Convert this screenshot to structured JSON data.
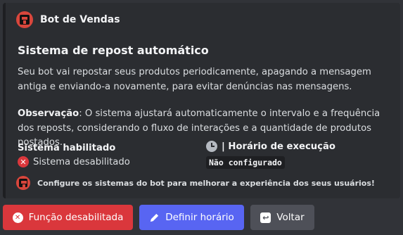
{
  "embed": {
    "author": "Bot de Vendas",
    "title": "Sistema de repost automático",
    "description": "Seu bot vai repostar seus produtos periodicamente, apagando a mensagem antiga e enviando-a novamente, para evitar denúncias nas mensagens.",
    "note_label": "Observação",
    "note_text": ": O sistema ajustará automaticamente o intervalo e a frequência dos reposts, considerando o fluxo de interações e a quantidade de produtos postados.",
    "fields": [
      {
        "name": "Sistema habilitado",
        "value": "Sistema desabilitado"
      },
      {
        "name": "| Horário de execução",
        "value": "Não configurado"
      }
    ],
    "footer": "Configure os sistemas do bot para melhorar a experiência dos seus usuários!"
  },
  "buttons": {
    "disabled_label": "Função desabilitada",
    "schedule_label": "Definir horário",
    "back_label": "Voltar"
  },
  "colors": {
    "background": "#313338",
    "embed_bg": "#2b2d31",
    "danger": "#da373c",
    "primary": "#5865f2",
    "secondary": "#4e5058"
  },
  "icons": {
    "author_avatar": "bot-avatar-icon",
    "disabled_status": "x-circle-icon",
    "schedule_field": "clock-icon",
    "footer_avatar": "bot-avatar-icon",
    "disabled_button": "x-circle-icon",
    "schedule_button": "pencil-icon",
    "back_button": "back-arrow-icon"
  }
}
